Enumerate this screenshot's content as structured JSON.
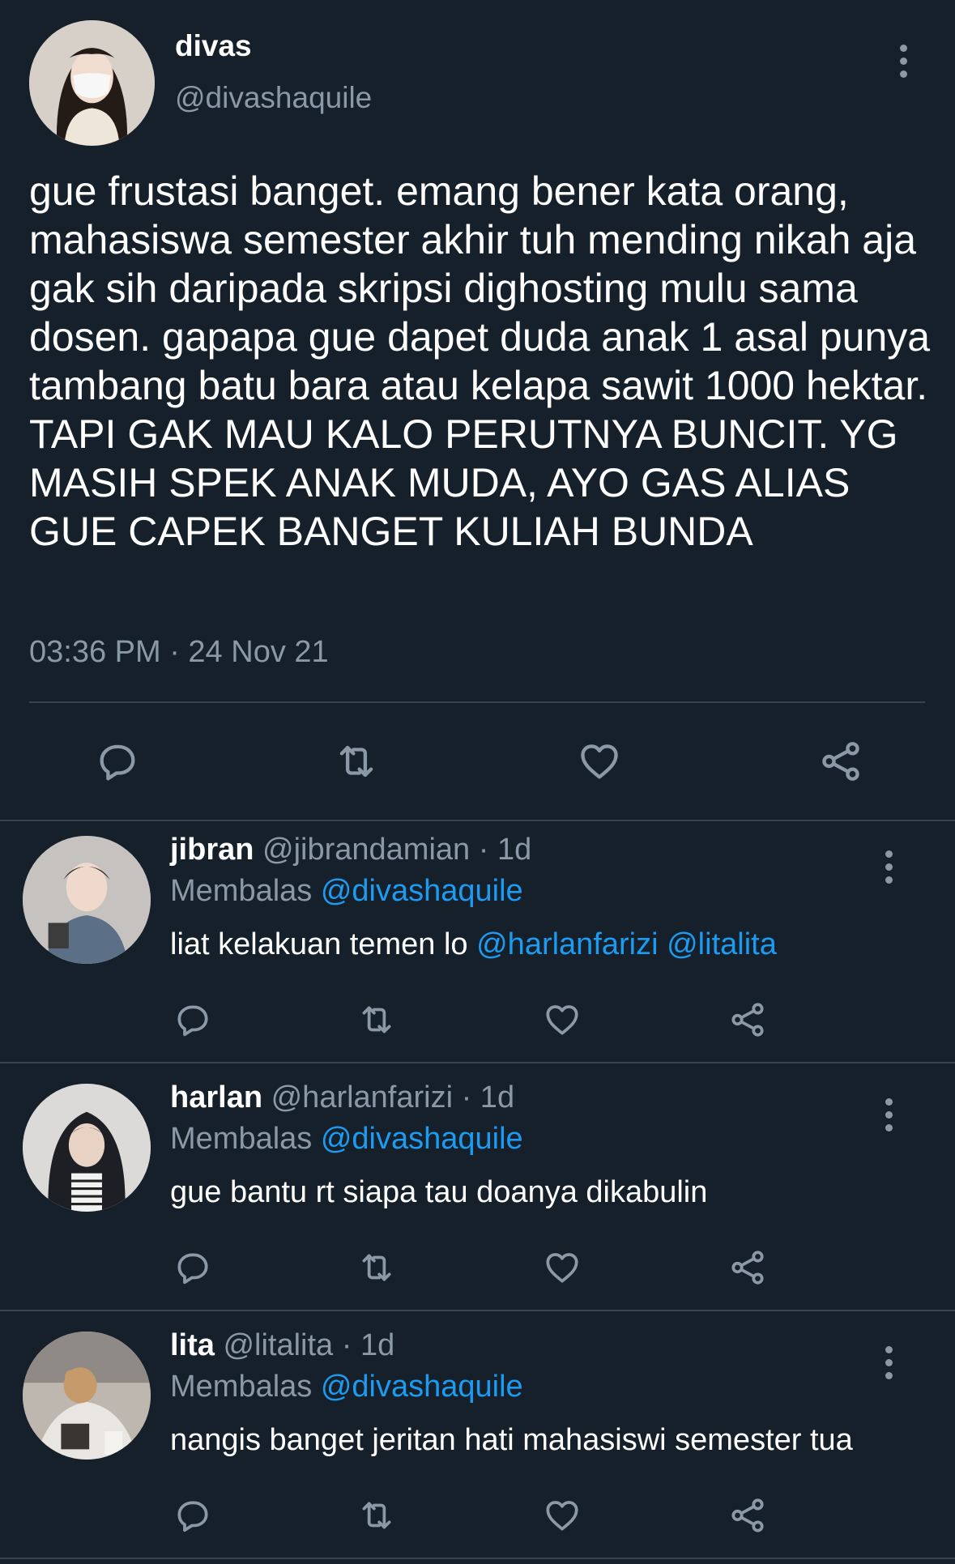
{
  "main_tweet": {
    "name": "divas",
    "handle": "@divashaquile",
    "text": "gue frustasi banget. emang bener kata orang, mahasiswa semester akhir tuh mending nikah aja gak sih daripada skripsi dighosting mulu sama dosen. gapapa gue dapet duda anak 1 asal punya tambang batu bara atau kelapa sawit 1000 hektar. TAPI GAK MAU KALO PERUTNYA BUNCIT. YG MASIH SPEK ANAK MUDA, AYO GAS ALIAS GUE CAPEK BANGET KULIAH BUNDA",
    "timestamp": "03:36 PM · 24 Nov 21",
    "actions": [
      "reply-icon",
      "retweet-icon",
      "like-icon",
      "share-icon"
    ]
  },
  "replies": [
    {
      "name": "jibran",
      "handle_time": " @jibrandamian · 1d",
      "replying_prefix": "Membalas ",
      "replying_to": "@divashaquile",
      "text_prefix": "liat kelakuan temen lo ",
      "mention1": "@harlanfarizi",
      "mention2": "@litalita",
      "text": ""
    },
    {
      "name": "harlan",
      "handle_time": " @harlanfarizi · 1d",
      "replying_prefix": "Membalas ",
      "replying_to": "@divashaquile",
      "text": "gue bantu rt siapa tau doanya dikabulin"
    },
    {
      "name": "lita",
      "handle_time": " @litalita · 1d",
      "replying_prefix": "Membalas ",
      "replying_to": "@divashaquile",
      "text": "nangis banget jeritan hati mahasiswi semester tua"
    }
  ],
  "colors": {
    "background": "#15202b",
    "secondary_text": "#8b98a5",
    "link": "#1d9bf0",
    "divider": "#38444d"
  }
}
